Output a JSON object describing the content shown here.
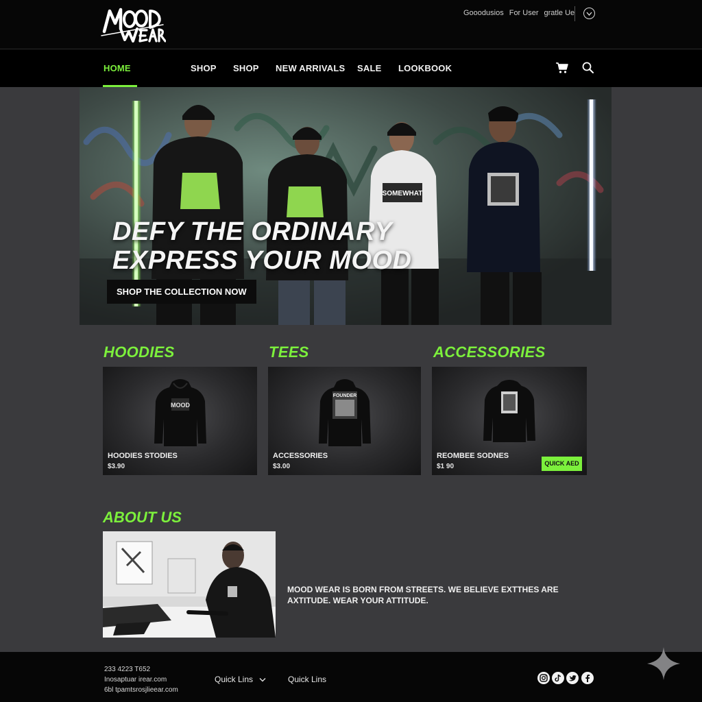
{
  "brand": {
    "logo_line1": "Mood",
    "logo_line2": "WEAR"
  },
  "utility": {
    "link1": "Gooodusios",
    "link2": "For User",
    "link3": "gratle Ue"
  },
  "nav": {
    "items": [
      {
        "label": "HOME",
        "active": true
      },
      {
        "label": "SHOP"
      },
      {
        "label": "SHOP"
      },
      {
        "label": "NEW ARRIVALS"
      },
      {
        "label": "SALE"
      },
      {
        "label": "LOOKBOOK"
      }
    ],
    "cart_icon": "cart-icon",
    "search_icon": "search-icon"
  },
  "hero": {
    "headline_line1": "DEFY THE ORDINARY",
    "headline_line2": "EXPRESS YOUR MOOD",
    "cta_label": "SHOP THE COLLECTION NOW",
    "shirt_print": "SOMEWHAT"
  },
  "categories": [
    {
      "title": "HOODIES",
      "product_name": "HOODIES STODIES",
      "price": "$3.90",
      "print_text": "MOOD"
    },
    {
      "title": "TEES",
      "product_name": "ACCESSORIES",
      "price": "$3.00",
      "print_text": "FOUNDER"
    },
    {
      "title": "ACCESSORIES",
      "product_name": "REOMBEE SODNES",
      "price": "$1 90",
      "quick_add": "QUICK AED"
    }
  ],
  "about": {
    "title": "ABOUT US",
    "text": "MOOD WEAR IS BORN FROM STREETS. WE BELIEVE EXTTHES ARE AXTITUDE. WEAR YOUR ATTITUDE."
  },
  "footer": {
    "phone": "233 4223 T652",
    "email1": "Inosaptuar irear.com",
    "email2": "6bl tpamtsrosjlieear.com",
    "quick_links_1": "Quick Lins",
    "quick_links_2": "Quick Lins",
    "socials": [
      "instagram-icon",
      "tiktok-icon",
      "twitter-icon",
      "facebook-icon"
    ]
  },
  "colors": {
    "accent": "#7cf03c",
    "background": "#3a3a3d",
    "bar": "#060606"
  }
}
